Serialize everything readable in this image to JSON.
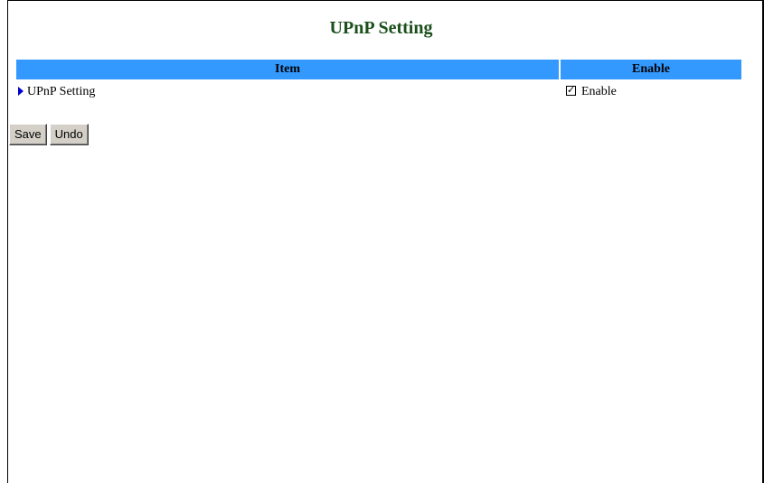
{
  "page": {
    "title": "UPnP Setting"
  },
  "table": {
    "headers": {
      "item": "Item",
      "enable": "Enable"
    },
    "rows": [
      {
        "label": "UPnP Setting",
        "checked": true,
        "checkbox_label": "Enable"
      }
    ]
  },
  "buttons": {
    "save_label": "Save",
    "undo_label": "Undo"
  },
  "colors": {
    "title": "#1c4f1c",
    "header_bg": "#3399ff",
    "arrow": "#0000cc",
    "button_bg": "#d4d0c8"
  },
  "icons": {
    "row_marker": "arrow-right-icon",
    "checkbox": "checkbox-checked-icon"
  }
}
